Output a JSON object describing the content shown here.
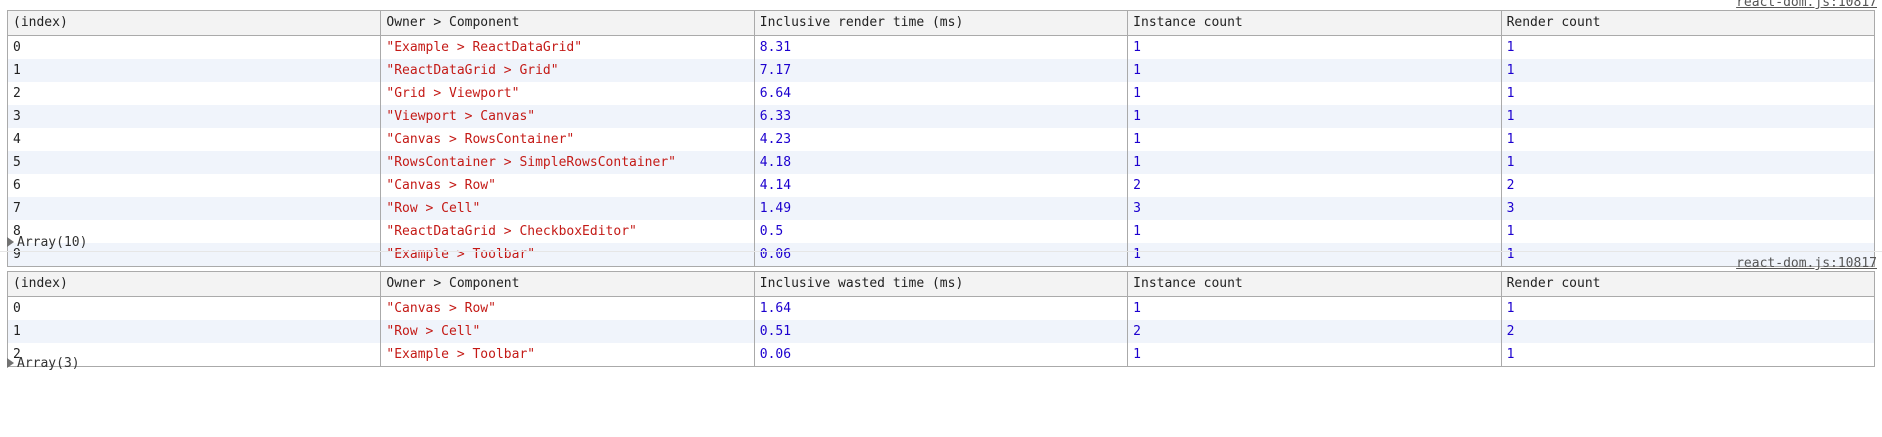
{
  "log1": {
    "source": "react-dom.js:10817",
    "columns": [
      "(index)",
      "Owner > Component",
      "Inclusive render time (ms)",
      "Instance count",
      "Render count"
    ],
    "rows": [
      [
        "0",
        "\"Example > ReactDataGrid\"",
        "8.31",
        "1",
        "1"
      ],
      [
        "1",
        "\"ReactDataGrid > Grid\"",
        "7.17",
        "1",
        "1"
      ],
      [
        "2",
        "\"Grid > Viewport\"",
        "6.64",
        "1",
        "1"
      ],
      [
        "3",
        "\"Viewport > Canvas\"",
        "6.33",
        "1",
        "1"
      ],
      [
        "4",
        "\"Canvas > RowsContainer\"",
        "4.23",
        "1",
        "1"
      ],
      [
        "5",
        "\"RowsContainer > SimpleRowsContainer\"",
        "4.18",
        "1",
        "1"
      ],
      [
        "6",
        "\"Canvas > Row\"",
        "4.14",
        "2",
        "2"
      ],
      [
        "7",
        "\"Row > Cell\"",
        "1.49",
        "3",
        "3"
      ],
      [
        "8",
        "\"ReactDataGrid > CheckboxEditor\"",
        "0.5",
        "1",
        "1"
      ],
      [
        "9",
        "\"Example > Toolbar\"",
        "0.06",
        "1",
        "1"
      ]
    ],
    "array_label": "Array(10)"
  },
  "log2": {
    "source": "react-dom.js:10817",
    "columns": [
      "(index)",
      "Owner > Component",
      "Inclusive wasted time (ms)",
      "Instance count",
      "Render count"
    ],
    "rows": [
      [
        "0",
        "\"Canvas > Row\"",
        "1.64",
        "1",
        "1"
      ],
      [
        "1",
        "\"Row > Cell\"",
        "0.51",
        "2",
        "2"
      ],
      [
        "2",
        "\"Example > Toolbar\"",
        "0.06",
        "1",
        "1"
      ]
    ],
    "array_label": "Array(3)"
  },
  "colors": {
    "string": "#c41a16",
    "number": "#1c00cf",
    "header_bg": "#f3f3f3",
    "stripe_bg": "#f0f4fb",
    "border": "#aaaaaa"
  }
}
